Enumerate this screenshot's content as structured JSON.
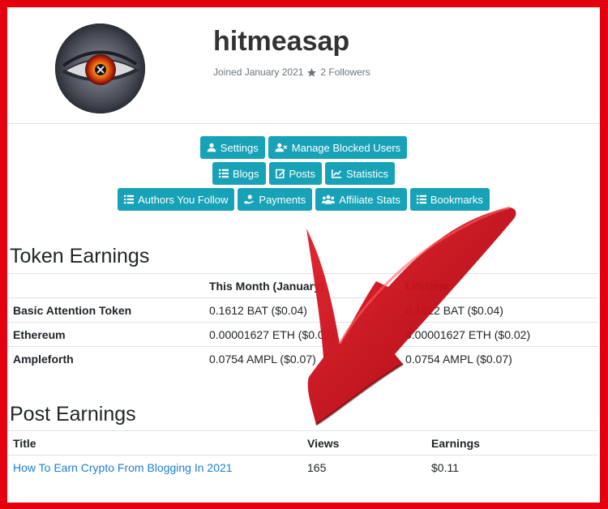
{
  "profile": {
    "username": "hitmeasap",
    "joined": "Joined January 2021",
    "followers": "2 Followers"
  },
  "nav": {
    "settings": "Settings",
    "manage_blocked": "Manage Blocked Users",
    "blogs": "Blogs",
    "posts": "Posts",
    "statistics": "Statistics",
    "authors_you_follow": "Authors You Follow",
    "payments": "Payments",
    "affiliate_stats": "Affiliate Stats",
    "bookmarks": "Bookmarks"
  },
  "token_earnings": {
    "title": "Token Earnings",
    "headers": [
      "",
      "This Month (January)",
      "Lifetime"
    ],
    "rows": [
      {
        "token": "Basic Attention Token",
        "month": "0.1612 BAT ($0.04)",
        "lifetime": "0.1612 BAT ($0.04)"
      },
      {
        "token": "Ethereum",
        "month": "0.00001627 ETH ($0.02)",
        "lifetime": "0.00001627 ETH ($0.02)"
      },
      {
        "token": "Ampleforth",
        "month": "0.0754 AMPL ($0.07)",
        "lifetime": "0.0754 AMPL ($0.07)"
      }
    ]
  },
  "post_earnings": {
    "title": "Post Earnings",
    "headers": [
      "Title",
      "Views",
      "Earnings"
    ],
    "rows": [
      {
        "title": "How To Earn Crypto From Blogging In 2021",
        "views": "165",
        "earnings": "$0.11"
      }
    ]
  },
  "colors": {
    "frame": "#e3000f",
    "button": "#17a2b8",
    "link": "#1a7fd4",
    "arrow": "#c8101a"
  }
}
